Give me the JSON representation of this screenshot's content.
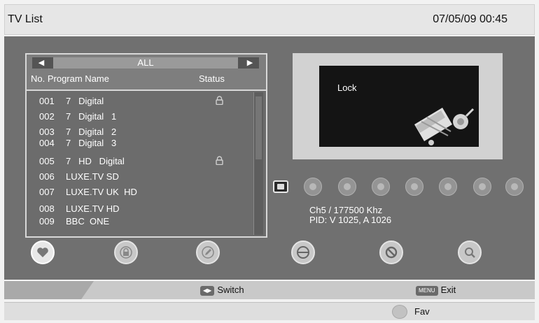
{
  "header": {
    "title": "TV List",
    "datetime": "07/05/09  00:45"
  },
  "list": {
    "category": "ALL",
    "columns": {
      "program": "No. Program Name",
      "status": "Status"
    },
    "channels": [
      {
        "num": "001",
        "name": "7   Digital",
        "locked": true
      },
      {
        "num": "002",
        "name": "7   Digital   1",
        "locked": false
      },
      {
        "num": "003",
        "name": "7   Digital   2",
        "locked": false
      },
      {
        "num": "004",
        "name": "7   Digital   3",
        "locked": false
      },
      {
        "num": "005",
        "name": "7   HD   Digital",
        "locked": true
      },
      {
        "num": "006",
        "name": "LUXE.TV SD",
        "locked": false
      },
      {
        "num": "007",
        "name": "LUXE.TV UK  HD",
        "locked": false
      },
      {
        "num": "008",
        "name": "LUXE.TV HD",
        "locked": false
      },
      {
        "num": "009",
        "name": "BBC  ONE",
        "locked": false
      }
    ]
  },
  "preview": {
    "text": "Lock"
  },
  "info": {
    "freq": "Ch5 / 177500  Khz",
    "pid": "PID: V 1025, A 1026"
  },
  "genres": [
    "all-icon",
    "film-icon",
    "news-icon",
    "music-icon",
    "kids-icon",
    "travel-icon",
    "people-icon",
    "person-icon"
  ],
  "actions": [
    "favorite-heart-icon",
    "lock-icon",
    "edit-pencil-icon",
    "skip-icon",
    "delete-icon",
    "find-icon"
  ],
  "help": {
    "switch_key": "◀▶",
    "switch_label": "Switch",
    "exit_key": "MENU",
    "exit_label": "Exit",
    "fav_label": "Fav"
  },
  "colors": {
    "panel": "#707070",
    "accent": "#d8d8d8"
  }
}
